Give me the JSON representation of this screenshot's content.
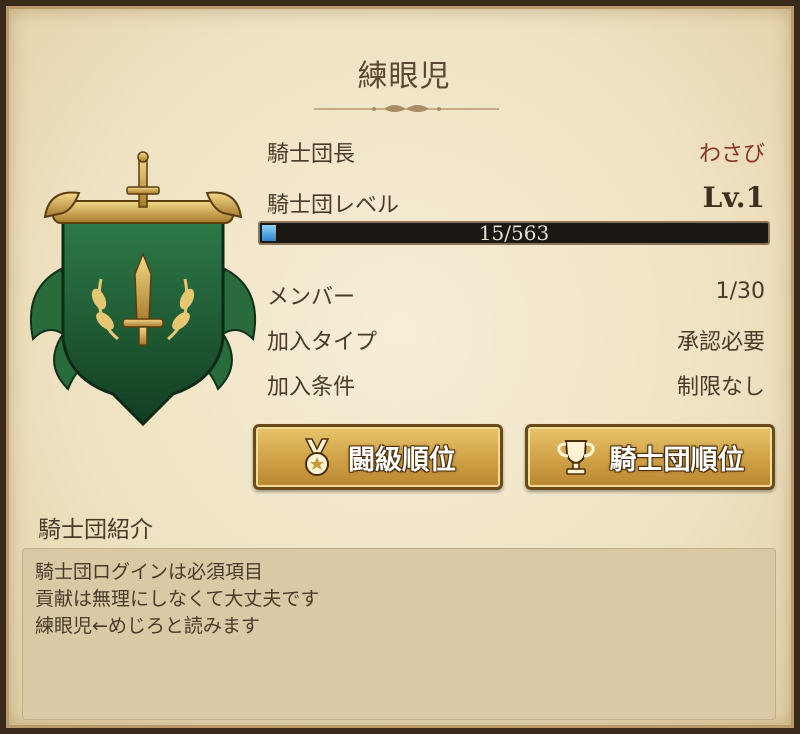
{
  "guild": {
    "name": "練眼児",
    "leader_label": "騎士団長",
    "leader_value": "わさび",
    "level_label": "騎士団レベル",
    "level_value": "Lv.1",
    "exp_text": "15/563",
    "exp_progress": 0.027,
    "members_label": "メンバー",
    "members_value": "1/30",
    "join_type_label": "加入タイプ",
    "join_type_value": "承認必要",
    "join_cond_label": "加入条件",
    "join_cond_value": "制限なし"
  },
  "buttons": {
    "battle_rank": "闘級順位",
    "guild_rank": "騎士団順位",
    "battle_rank_icon": "medal-icon",
    "guild_rank_icon": "trophy-icon"
  },
  "intro": {
    "heading": "騎士団紹介",
    "lines": [
      "騎士団ログインは必須項目",
      "貢献は無理にしなくて大丈夫です",
      "練眼児←めじろと読みます"
    ]
  },
  "colors": {
    "parchment": "#efe2c2",
    "crest_green": "#1f5a35",
    "gold": "#d2a449",
    "leader_red": "#8a3322"
  }
}
